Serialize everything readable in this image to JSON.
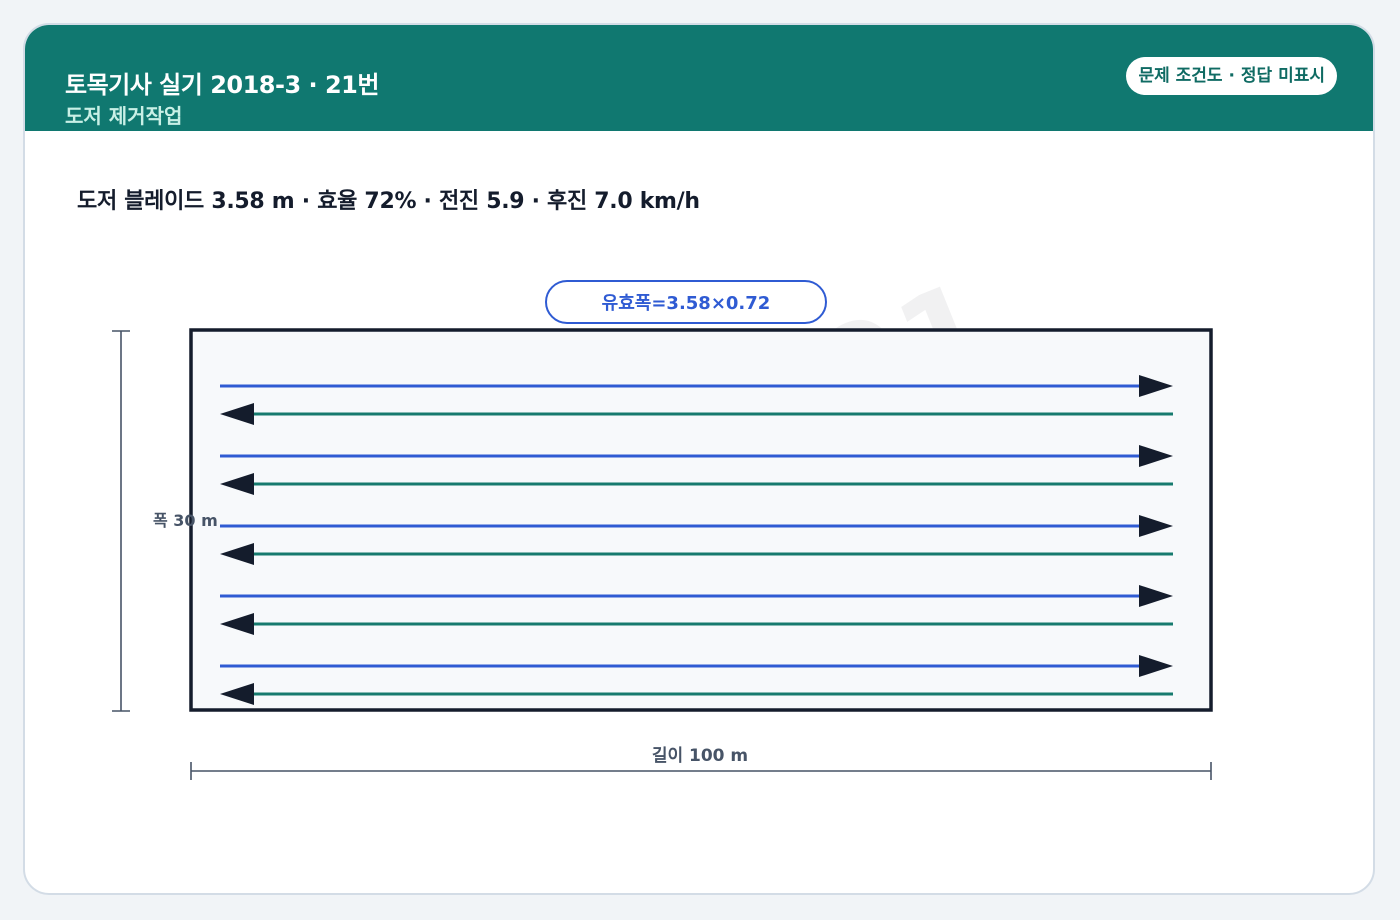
{
  "header": {
    "title": "토목기사 실기 2018-3 · 21번",
    "subtitle": "도저 제거작업",
    "badge": "문제 조건도 · 정답 미표시"
  },
  "condition_text": "도저 블레이드 3.58 m · 효율 72% · 전진 5.9 · 후진 7.0 km/h",
  "diagram": {
    "effective_width_label": "유효폭=3.58×0.72",
    "width_label": "폭 30 m",
    "length_label": "길이 100 m",
    "watermark": "자격증3001",
    "passes": 5,
    "colors": {
      "forward": "#2f5bd3",
      "backward": "#167a6e",
      "border": "#141c2c",
      "field_bg": "#f7f9fb"
    }
  }
}
